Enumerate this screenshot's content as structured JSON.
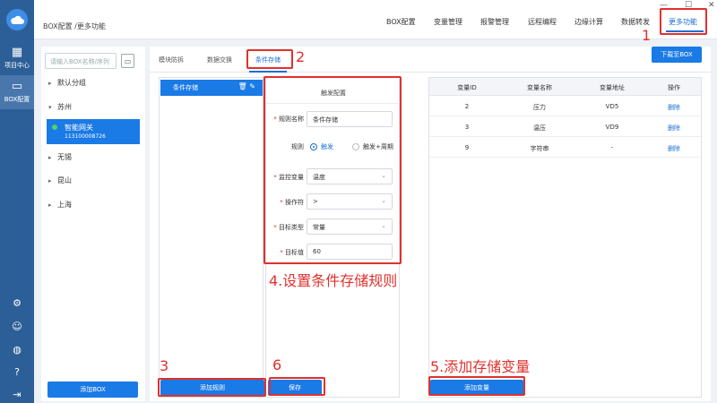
{
  "rail": {
    "items": [
      {
        "label": "项目中心",
        "icon": "grid-icon"
      },
      {
        "label": "BOX配置",
        "icon": "monitor-icon"
      }
    ],
    "bottom_icons": [
      "gear-icon",
      "user-icon",
      "globe-icon",
      "help-icon",
      "logout-icon"
    ]
  },
  "header": {
    "breadcrumb": "BOX配置 /更多功能",
    "nav": [
      "BOX配置",
      "变量管理",
      "报警管理",
      "远程编程",
      "边缘计算",
      "数据转发",
      "更多功能"
    ],
    "active_nav": "更多功能",
    "window_controls": [
      "—",
      "☐",
      "✕"
    ]
  },
  "tree": {
    "search_placeholder": "请输入BOX名称/序列",
    "groups": [
      "默认分组",
      "苏州",
      "无锡",
      "昆山",
      "上海"
    ],
    "device": {
      "name": "智能网关",
      "serial": "113100008726"
    },
    "add_button": "添加BOX"
  },
  "main": {
    "tabs": [
      "模块防拆",
      "数据交换",
      "条件存储"
    ],
    "active_tab": "条件存储",
    "download_button": "下载至BOX",
    "rule_list": {
      "items": [
        "条件存储"
      ],
      "add_button": "添加规则"
    },
    "form": {
      "title": "触发配置",
      "rule_name_label": "规则名称",
      "rule_name_value": "条件存储",
      "rule_label": "规则",
      "rule_options": [
        "触发",
        "触发+周期"
      ],
      "rule_selected": "触发",
      "monitor_var_label": "监控变量",
      "monitor_var_value": "温度",
      "operator_label": "操作符",
      "operator_value": ">",
      "target_type_label": "目标类型",
      "target_type_value": "常量",
      "target_value_label": "目标值",
      "target_value": "60",
      "save_button": "保存"
    },
    "var_table": {
      "headers": [
        "变量ID",
        "变量名称",
        "变量地址",
        "操作"
      ],
      "rows": [
        {
          "id": "2",
          "name": "压力",
          "address": "VD5",
          "action": "删除"
        },
        {
          "id": "3",
          "name": "温压",
          "address": "VD9",
          "action": "删除"
        },
        {
          "id": "9",
          "name": "字符串",
          "address": "-",
          "action": "删除"
        }
      ],
      "add_button": "添加变量"
    }
  },
  "annotations": {
    "n1": "1",
    "n2": "2",
    "n3": "3",
    "n4": "4.设置条件存储规则",
    "n5": "5.添加存储变量",
    "n6": "6"
  },
  "colors": {
    "accent": "#1a7ae6",
    "rail": "#2c5f97",
    "annotation": "#e2302b"
  }
}
